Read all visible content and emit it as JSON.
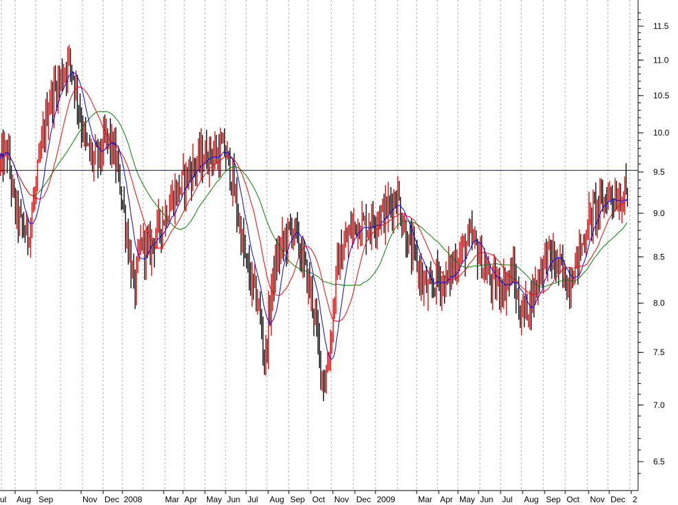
{
  "chart_data": {
    "type": "line",
    "subtype": "price-bars-with-moving-averages",
    "scale": "log",
    "grid": "vertical-dotted",
    "x_tick_labels": [
      "ul",
      "Aug",
      "Sep",
      "Nov",
      "Dec",
      "2008",
      "Mar",
      "Apr",
      "May",
      "Jun",
      "Jul",
      "Aug",
      "Sep",
      "Oct",
      "Nov",
      "Dec",
      "2009",
      "Mar",
      "Apr",
      "May",
      "Jun",
      "Jul",
      "Aug",
      "Sep",
      "Oct",
      "Nov",
      "Dec",
      "2"
    ],
    "y_tick_labels": [
      "11.5",
      "11.0",
      "10.5",
      "10.0",
      "9.5",
      "9.0",
      "8.5",
      "8.0",
      "7.5",
      "7.0",
      "6.5"
    ],
    "ylim": [
      6.3,
      11.8
    ],
    "horizontal_line": {
      "value": 9.52,
      "color": "#0000ff"
    },
    "price_path": [
      [
        0,
        9.6
      ],
      [
        10,
        9.78
      ],
      [
        20,
        9.1
      ],
      [
        30,
        8.85
      ],
      [
        40,
        8.75
      ],
      [
        50,
        9.2
      ],
      [
        60,
        9.8
      ],
      [
        70,
        10.4
      ],
      [
        80,
        10.6
      ],
      [
        90,
        10.8
      ],
      [
        100,
        11.0
      ],
      [
        105,
        10.85
      ],
      [
        115,
        10.3
      ],
      [
        125,
        9.8
      ],
      [
        135,
        9.65
      ],
      [
        145,
        9.7
      ],
      [
        155,
        9.95
      ],
      [
        165,
        9.75
      ],
      [
        175,
        9.3
      ],
      [
        185,
        8.7
      ],
      [
        195,
        8.1
      ],
      [
        205,
        8.7
      ],
      [
        215,
        8.55
      ],
      [
        225,
        8.75
      ],
      [
        235,
        8.9
      ],
      [
        245,
        9.1
      ],
      [
        260,
        9.3
      ],
      [
        275,
        9.5
      ],
      [
        290,
        9.65
      ],
      [
        305,
        9.75
      ],
      [
        315,
        9.7
      ],
      [
        325,
        9.8
      ],
      [
        335,
        9.5
      ],
      [
        345,
        9.0
      ],
      [
        355,
        8.5
      ],
      [
        365,
        8.2
      ],
      [
        375,
        8.0
      ],
      [
        385,
        7.4
      ],
      [
        395,
        8.2
      ],
      [
        405,
        8.55
      ],
      [
        415,
        8.7
      ],
      [
        425,
        8.85
      ],
      [
        435,
        8.6
      ],
      [
        445,
        8.3
      ],
      [
        455,
        8.0
      ],
      [
        465,
        7.4
      ],
      [
        472,
        7.2
      ],
      [
        480,
        7.6
      ],
      [
        490,
        8.4
      ],
      [
        500,
        8.6
      ],
      [
        510,
        8.8
      ],
      [
        520,
        8.9
      ],
      [
        530,
        8.85
      ],
      [
        540,
        8.9
      ],
      [
        550,
        9.0
      ],
      [
        560,
        9.0
      ],
      [
        570,
        9.15
      ],
      [
        578,
        9.2
      ],
      [
        585,
        8.9
      ],
      [
        595,
        8.6
      ],
      [
        605,
        8.45
      ],
      [
        615,
        8.2
      ],
      [
        625,
        8.1
      ],
      [
        635,
        8.3
      ],
      [
        645,
        8.2
      ],
      [
        655,
        8.35
      ],
      [
        665,
        8.5
      ],
      [
        675,
        8.6
      ],
      [
        685,
        8.7
      ],
      [
        695,
        8.55
      ],
      [
        705,
        8.35
      ],
      [
        715,
        8.2
      ],
      [
        725,
        8.2
      ],
      [
        735,
        8.2
      ],
      [
        745,
        8.35
      ],
      [
        755,
        7.9
      ],
      [
        765,
        7.95
      ],
      [
        775,
        8.1
      ],
      [
        785,
        8.35
      ],
      [
        795,
        8.55
      ],
      [
        805,
        8.45
      ],
      [
        815,
        8.35
      ],
      [
        825,
        8.2
      ],
      [
        835,
        8.4
      ],
      [
        845,
        8.6
      ],
      [
        855,
        8.9
      ],
      [
        865,
        9.05
      ],
      [
        875,
        9.1
      ],
      [
        885,
        9.25
      ],
      [
        895,
        9.2
      ],
      [
        905,
        9.2
      ],
      [
        912,
        9.25
      ]
    ],
    "series": [
      {
        "color": "#000000",
        "role": "down-bars"
      },
      {
        "color": "#ff0000",
        "role": "up-bars"
      },
      {
        "color": "#0000ff",
        "role": "moving-average-short"
      },
      {
        "color": "#ff0000",
        "role": "moving-average-medium"
      },
      {
        "color": "#008000",
        "role": "moving-average-long"
      }
    ]
  }
}
